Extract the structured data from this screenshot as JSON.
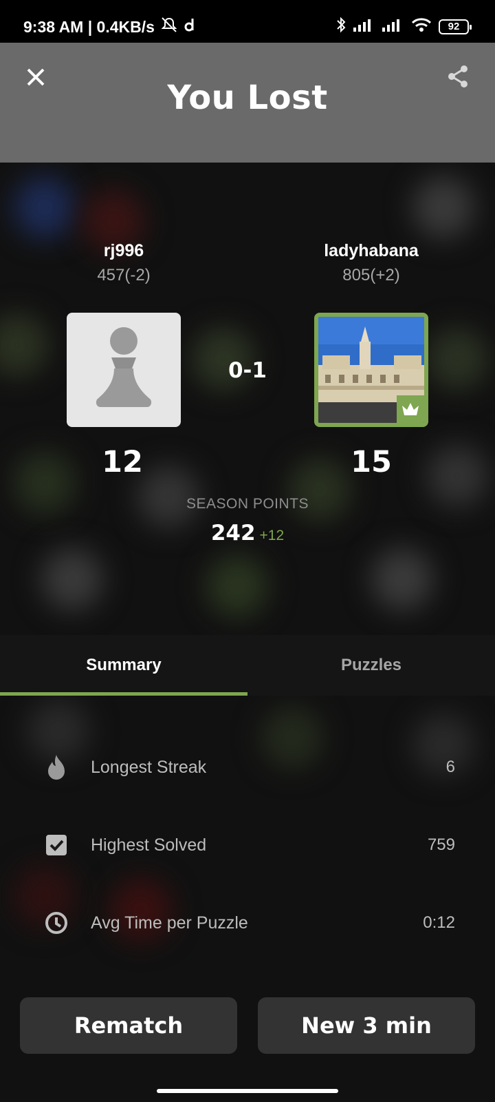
{
  "status_bar": {
    "time": "9:38 AM | 0.4KB/s",
    "battery": "92"
  },
  "header": {
    "title": "You Lost"
  },
  "players": {
    "left": {
      "name": "rj996",
      "rating": "457(-2)",
      "points": "12"
    },
    "right": {
      "name": "ladyhabana",
      "rating": "805(+2)",
      "points": "15"
    }
  },
  "result": {
    "score": "0-1"
  },
  "season": {
    "label": "SEASON POINTS",
    "value": "242",
    "delta": "+12"
  },
  "tabs": [
    {
      "label": "Summary",
      "active": true
    },
    {
      "label": "Puzzles",
      "active": false
    }
  ],
  "summary": [
    {
      "icon": "flame-icon",
      "label": "Longest Streak",
      "value": "6"
    },
    {
      "icon": "checkbox-icon",
      "label": "Highest Solved",
      "value": "759"
    },
    {
      "icon": "clock-icon",
      "label": "Avg Time per Puzzle",
      "value": "0:12"
    }
  ],
  "actions": {
    "rematch": "Rematch",
    "new_game": "New 3 min"
  },
  "colors": {
    "accent": "#7fa650",
    "header_bg": "#6a6a6a",
    "button_bg": "#333333"
  }
}
